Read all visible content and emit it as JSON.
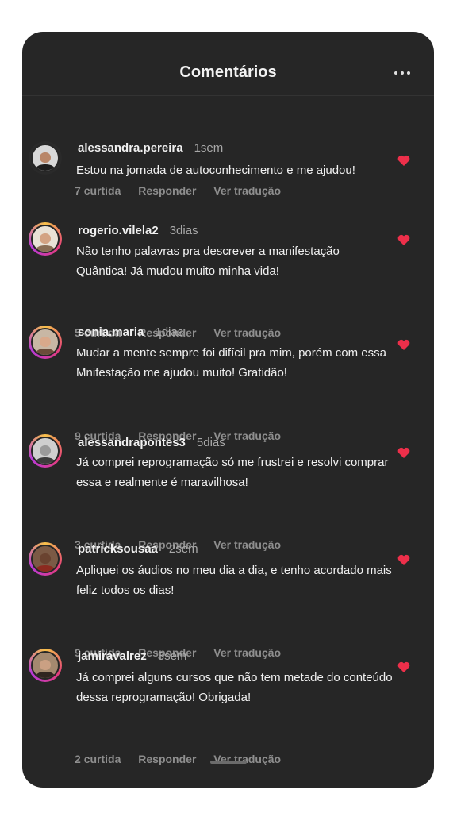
{
  "header": {
    "title": "Comentários",
    "more_icon": "more-horizontal-icon"
  },
  "action_labels": {
    "likes_suffix": "curtida",
    "reply": "Responder",
    "translate": "Ver tradução"
  },
  "colors": {
    "background": "#262626",
    "heart": "#ed2f4a",
    "text": "#f0f0f0",
    "muted": "#8e8e8e"
  },
  "comments": [
    {
      "username": "alessandra.pereira",
      "time": "1sem",
      "text": "Estou na jornada de autoconhecimento e me ajudou!",
      "likes": "7"
    },
    {
      "username": "rogerio.vilela2",
      "time": "3dias",
      "text": "Não tenho palavras pra descrever a manifestação Quântica! Já mudou muito minha vida!",
      "likes": "5"
    },
    {
      "username": "sonia.maria",
      "time": "1dias",
      "text": "Mudar a mente sempre foi difícil pra mim, porém com essa  Mnifestação me ajudou muito! Gratidão!",
      "likes": "9"
    },
    {
      "username": "alessandrapontes3",
      "time": "5dias",
      "text": "Já comprei reprogramação só me frustrei e resolvi comprar essa e realmente é maravilhosa!",
      "likes": "3"
    },
    {
      "username": "patricksousaa",
      "time": "2sem",
      "text": "Apliquei os áudios no meu dia a dia, e tenho acordado mais feliz todos os dias!",
      "likes": "9"
    },
    {
      "username": "jamiravalrez",
      "time": "3sem",
      "text": "Já comprei alguns cursos que não tem metade do conteúdo dessa reprogramação! Obrigada!",
      "likes": "2"
    }
  ]
}
